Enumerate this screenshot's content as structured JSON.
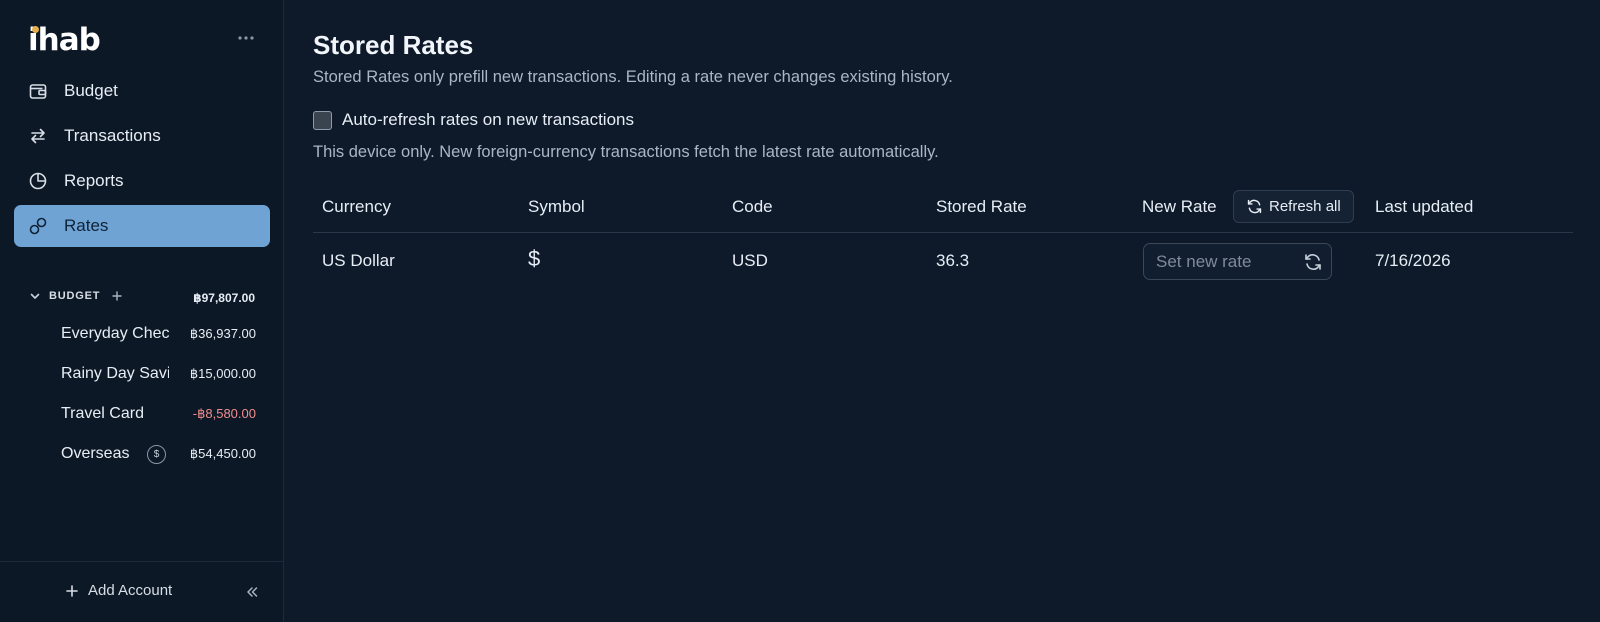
{
  "app": {
    "logo": "ihab"
  },
  "sidebar": {
    "nav": [
      {
        "label": "Budget",
        "icon": "wallet-icon"
      },
      {
        "label": "Transactions",
        "icon": "arrows-swap-icon"
      },
      {
        "label": "Reports",
        "icon": "pie-chart-icon"
      },
      {
        "label": "Rates",
        "icon": "currency-exchange-icon",
        "active": true
      }
    ],
    "group": {
      "name": "BUDGET",
      "total": "฿97,807.00"
    },
    "accounts": [
      {
        "name": "Everyday Checking",
        "balance": "฿36,937.00"
      },
      {
        "name": "Rainy Day Savings",
        "balance": "฿15,000.00"
      },
      {
        "name": "Travel Card",
        "balance": "-฿8,580.00",
        "negative": true
      },
      {
        "name": "Overseas",
        "badge": "$",
        "balance": "฿54,450.00"
      }
    ],
    "add_account": "Add Account"
  },
  "page": {
    "title": "Stored Rates",
    "subtitle": "Stored Rates only prefill new transactions. Editing a rate never changes existing history.",
    "auto_refresh_label": "Auto-refresh rates on new transactions",
    "auto_refresh_checked": false,
    "device_note": "This device only. New foreign-currency transactions fetch the latest rate automatically."
  },
  "table": {
    "headers": {
      "currency": "Currency",
      "symbol": "Symbol",
      "code": "Code",
      "stored_rate": "Stored Rate",
      "new_rate": "New Rate",
      "last_updated": "Last updated"
    },
    "refresh_all_label": "Refresh all",
    "rows": [
      {
        "currency": "US Dollar",
        "symbol": "$",
        "code": "USD",
        "stored_rate": "36.3",
        "new_rate_placeholder": "Set new rate",
        "new_rate_value": "",
        "last_updated": "7/16/2026"
      }
    ]
  },
  "colors": {
    "background": "#0e1a2a",
    "sidebar": "#0d1826",
    "active_nav": "#6ea3d4",
    "negative": "#f08e8e",
    "logo_dot": "#e8b04a"
  }
}
